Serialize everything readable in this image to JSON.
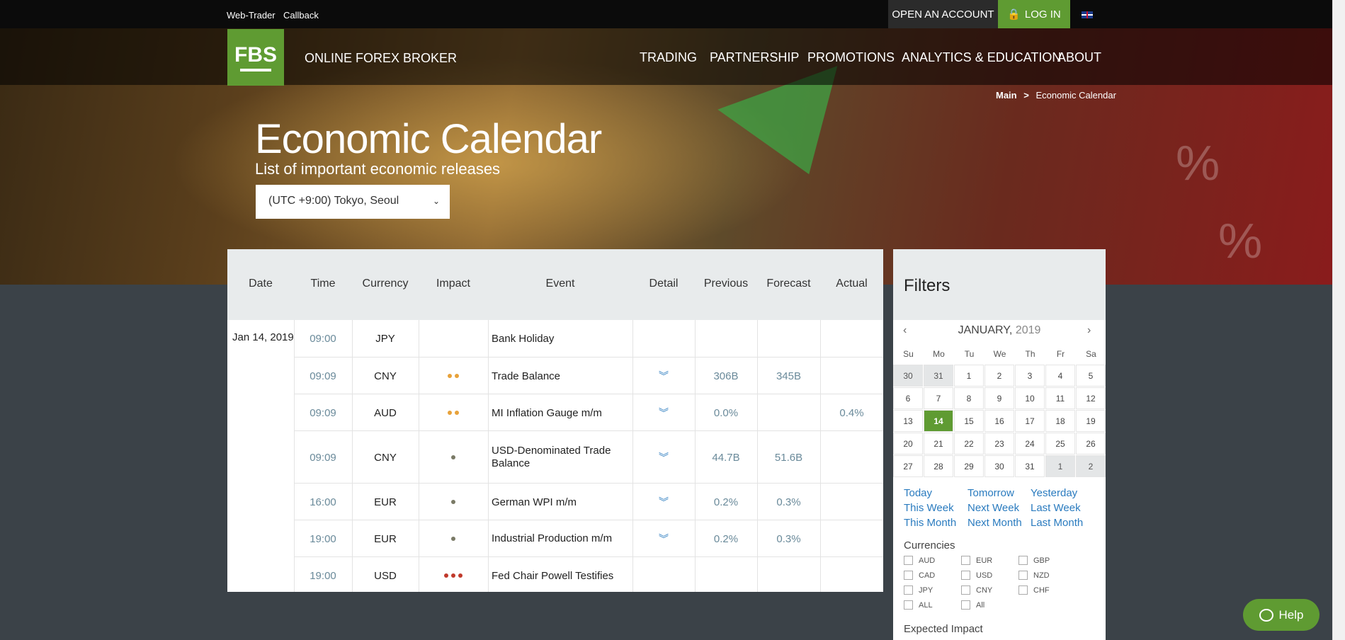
{
  "topbar": {
    "web_trader": "Web-Trader",
    "callback": "Callback",
    "open_account": "OPEN AN ACCOUNT",
    "login": "LOG IN"
  },
  "header": {
    "logo": "FBS",
    "tagline": "ONLINE FOREX BROKER",
    "nav": [
      "TRADING",
      "PARTNERSHIP",
      "PROMOTIONS",
      "ANALYTICS & EDUCATION",
      "ABOUT"
    ]
  },
  "breadcrumb": {
    "main": "Main",
    "sep": ">",
    "current": "Economic Calendar"
  },
  "page": {
    "title": "Economic Calendar",
    "subtitle": "List of important economic releases",
    "timezone": "(UTC +9:00) Tokyo, Seoul"
  },
  "table": {
    "headers": [
      "Date",
      "Time",
      "Currency",
      "Impact",
      "Event",
      "Detail",
      "Previous",
      "Forecast",
      "Actual"
    ],
    "date": "Jan 14, 2019",
    "rows": [
      {
        "time": "09:00",
        "currency": "JPY",
        "impact": 0,
        "event": "Bank Holiday",
        "detail": false,
        "previous": "",
        "forecast": "",
        "actual": ""
      },
      {
        "time": "09:09",
        "currency": "CNY",
        "impact": 2,
        "event": "Trade Balance",
        "detail": true,
        "previous": "306B",
        "forecast": "345B",
        "actual": ""
      },
      {
        "time": "09:09",
        "currency": "AUD",
        "impact": 2,
        "event": "MI Inflation Gauge m/m",
        "detail": true,
        "previous": "0.0%",
        "forecast": "",
        "actual": "0.4%"
      },
      {
        "time": "09:09",
        "currency": "CNY",
        "impact": 1,
        "event": "USD-Denominated Trade Balance",
        "detail": true,
        "previous": "44.7B",
        "forecast": "51.6B",
        "actual": ""
      },
      {
        "time": "16:00",
        "currency": "EUR",
        "impact": 1,
        "event": "German WPI m/m",
        "detail": true,
        "previous": "0.2%",
        "forecast": "0.3%",
        "actual": ""
      },
      {
        "time": "19:00",
        "currency": "EUR",
        "impact": 1,
        "event": "Industrial Production m/m",
        "detail": true,
        "previous": "0.2%",
        "forecast": "0.3%",
        "actual": ""
      },
      {
        "time": "19:00",
        "currency": "USD",
        "impact": 3,
        "event": "Fed Chair Powell Testifies",
        "detail": false,
        "previous": "",
        "forecast": "",
        "actual": ""
      }
    ],
    "impact_colors": {
      "low": "#7a7a66",
      "medium": "#e8a23a",
      "high": "#c0392b"
    }
  },
  "filters": {
    "title": "Filters",
    "calendar": {
      "month": "JANUARY,",
      "year": "2019",
      "dow": [
        "Su",
        "Mo",
        "Tu",
        "We",
        "Th",
        "Fr",
        "Sa"
      ],
      "weeks": [
        [
          "30",
          "31",
          "1",
          "2",
          "3",
          "4",
          "5"
        ],
        [
          "6",
          "7",
          "8",
          "9",
          "10",
          "11",
          "12"
        ],
        [
          "13",
          "14",
          "15",
          "16",
          "17",
          "18",
          "19"
        ],
        [
          "20",
          "21",
          "22",
          "23",
          "24",
          "25",
          "26"
        ],
        [
          "27",
          "28",
          "29",
          "30",
          "31",
          "1",
          "2"
        ]
      ],
      "selected": "14"
    },
    "quick": [
      [
        "Today",
        "Tomorrow",
        "Yesterday"
      ],
      [
        "This Week",
        "Next Week",
        "Last Week"
      ],
      [
        "This Month",
        "Next Month",
        "Last Month"
      ]
    ],
    "currencies_label": "Currencies",
    "currencies": [
      [
        "AUD",
        "EUR",
        "GBP"
      ],
      [
        "CAD",
        "USD",
        "NZD"
      ],
      [
        "JPY",
        "CNY",
        "CHF"
      ],
      [
        "ALL",
        "All"
      ]
    ],
    "expected_impact_label": "Expected Impact"
  },
  "help": {
    "label": "Help"
  },
  "colors": {
    "accent": "#5f9b32",
    "link": "#2a7bbf",
    "header_bg": "#e8ebec"
  }
}
